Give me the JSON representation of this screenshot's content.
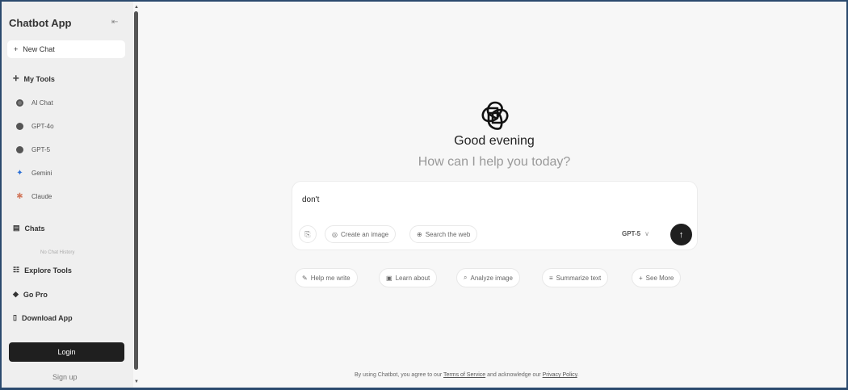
{
  "sidebar": {
    "app_title": "Chatbot App",
    "new_chat": "New Chat",
    "my_tools": "My Tools",
    "tools": [
      {
        "label": "AI Chat",
        "icon": "ai-chat-icon"
      },
      {
        "label": "GPT-4o",
        "icon": "gpt-icon"
      },
      {
        "label": "GPT-5",
        "icon": "gpt-icon"
      },
      {
        "label": "Gemini",
        "icon": "gemini-icon"
      },
      {
        "label": "Claude",
        "icon": "claude-icon"
      }
    ],
    "chats": "Chats",
    "no_history": "No Chat History",
    "explore_tools": "Explore Tools",
    "go_pro": "Go Pro",
    "download_app": "Download App",
    "login": "Login",
    "signup": "Sign up"
  },
  "main": {
    "greeting": "Good evening",
    "subgreeting": "How can I help you today?",
    "input_value": "don't",
    "create_image": "Create an image",
    "search_web": "Search the web",
    "model": "GPT-5",
    "suggestions": [
      "Help me write",
      "Learn about",
      "Analyze image",
      "Summarize text",
      "See More"
    ]
  },
  "footer": {
    "prefix": "By using Chatbot, you agree to our",
    "terms": "Terms of Service",
    "middle": "and acknowledge our",
    "privacy": "Privacy Policy",
    "suffix": "."
  },
  "colors": {
    "accent_dark": "#1f1f1f",
    "sidebar_bg": "#efefef",
    "main_bg": "#f7f7f7",
    "gemini_blue": "#2a6fd6",
    "claude_orange": "#d2795e"
  }
}
